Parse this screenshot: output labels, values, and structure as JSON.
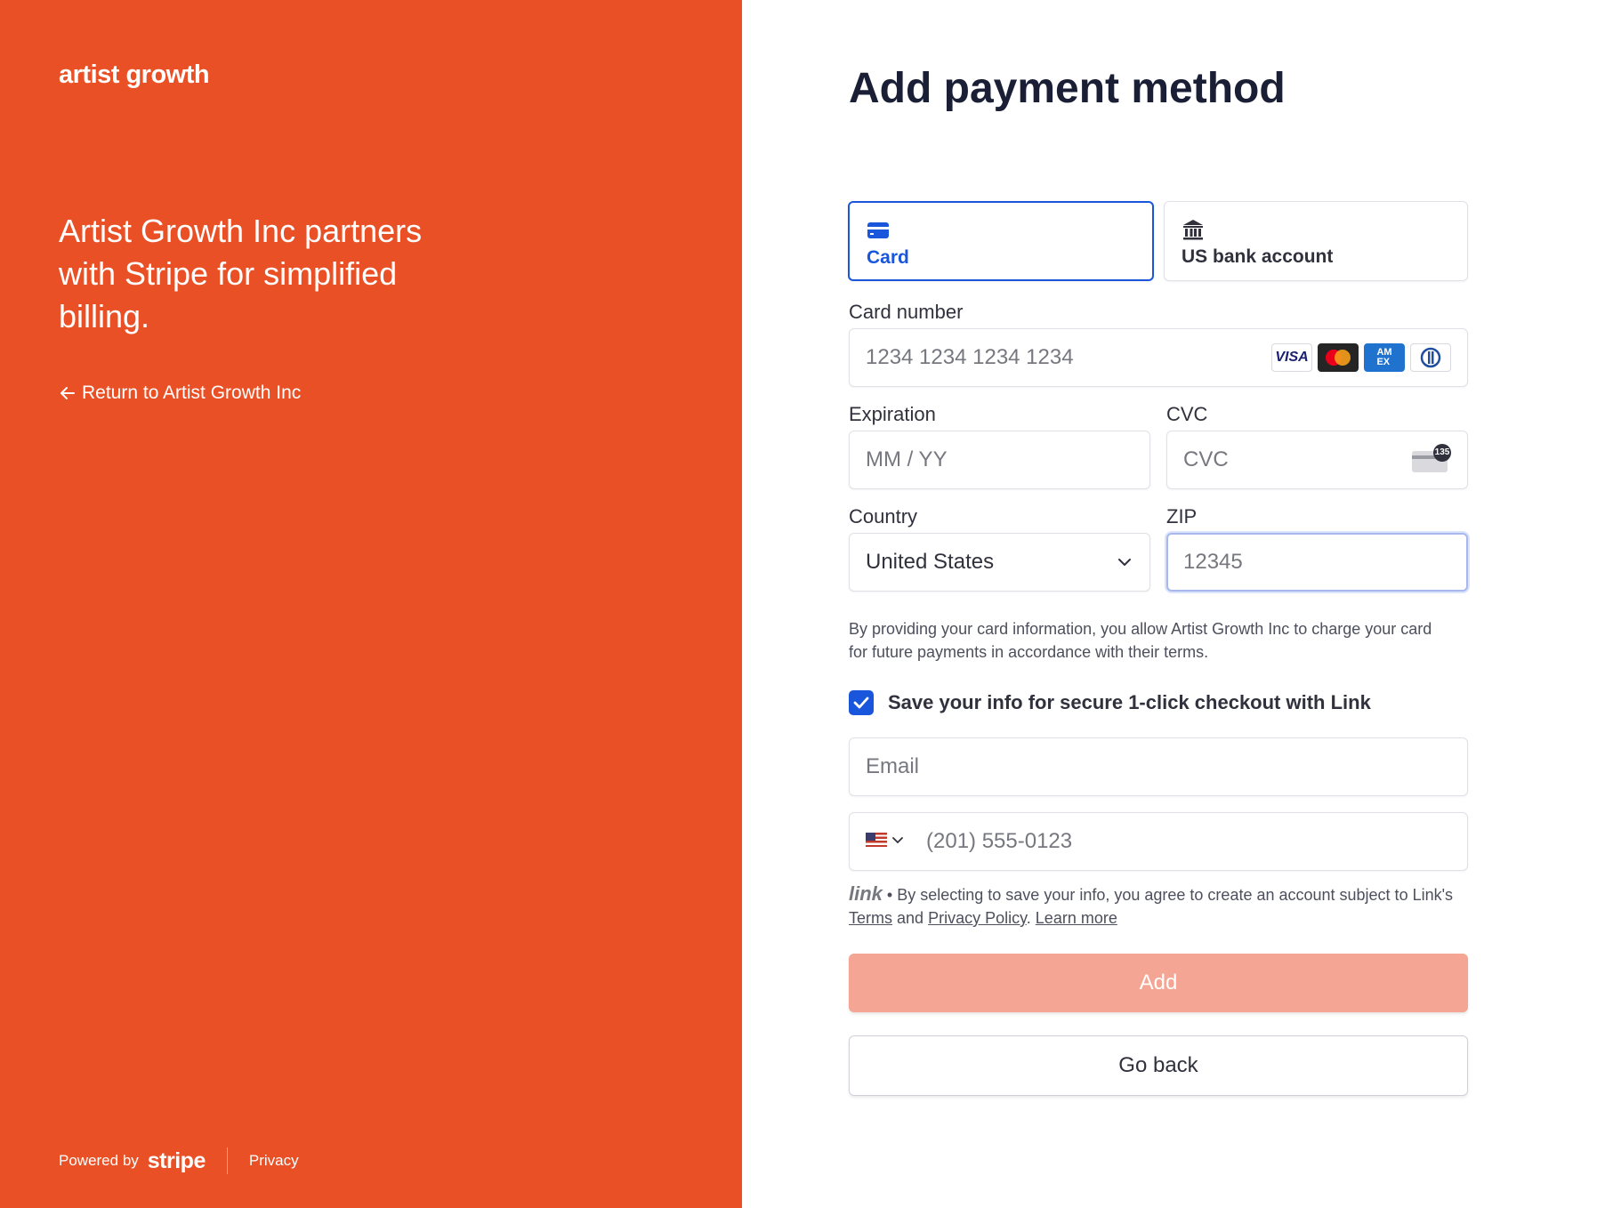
{
  "left_panel": {
    "logo_text": "artist growth",
    "tagline": "Artist Growth Inc partners with Stripe for simplified billing.",
    "return_link": "Return to Artist Growth Inc",
    "footer": {
      "powered_by": "Powered by",
      "stripe": "stripe",
      "privacy": "Privacy"
    },
    "background_color": "#ea5025"
  },
  "form": {
    "title": "Add payment method",
    "tabs": [
      {
        "label": "Card",
        "icon": "card-icon",
        "active": true
      },
      {
        "label": "US bank account",
        "icon": "bank-icon",
        "active": false
      }
    ],
    "card_number": {
      "label": "Card number",
      "placeholder": "1234 1234 1234 1234",
      "brands": [
        "VISA",
        "Mastercard",
        "AMEX",
        "Diners"
      ]
    },
    "expiration": {
      "label": "Expiration",
      "placeholder": "MM / YY"
    },
    "cvc": {
      "label": "CVC",
      "placeholder": "CVC",
      "hint_number": "135"
    },
    "country": {
      "label": "Country",
      "value": "United States"
    },
    "zip": {
      "label": "ZIP",
      "placeholder": "12345"
    },
    "notice": "By providing your card information, you allow Artist Growth Inc to charge your card for future payments in accordance with their terms.",
    "save_info": {
      "checked": true,
      "label": "Save your info for secure 1-click checkout with Link"
    },
    "email": {
      "placeholder": "Email"
    },
    "phone": {
      "placeholder": "(201) 555-0123",
      "country_flag": "us-flag"
    },
    "link_note": {
      "brand": "link",
      "text": "By selecting to save your info, you agree to create an account subject to Link's",
      "terms": "Terms",
      "and": "and",
      "privacy_policy": "Privacy Policy",
      "learn_more": "Learn more"
    },
    "add_button": "Add",
    "back_button": "Go back",
    "accent_color": "#1a56db",
    "add_button_color": "#f4a593"
  }
}
